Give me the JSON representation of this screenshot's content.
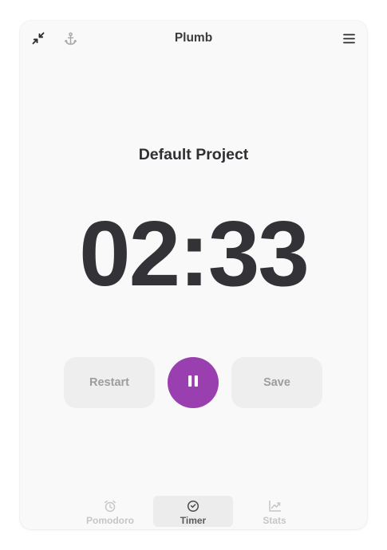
{
  "app": {
    "title": "Plumb"
  },
  "header": {
    "collapse_icon": "collapse-arrows-icon",
    "anchor_icon": "anchor-icon",
    "menu_icon": "hamburger-menu-icon"
  },
  "main": {
    "project_name": "Default Project",
    "time_display": "02:33"
  },
  "controls": {
    "restart_label": "Restart",
    "pause_icon": "pause-icon",
    "save_label": "Save"
  },
  "tabs": [
    {
      "label": "Pomodoro",
      "icon": "alarm-clock-icon",
      "active": false
    },
    {
      "label": "Timer",
      "icon": "clock-icon",
      "active": true
    },
    {
      "label": "Stats",
      "icon": "chart-line-icon",
      "active": false
    }
  ],
  "colors": {
    "accent": "#9a3fb0",
    "text_primary": "#323237",
    "button_bg": "#eeeeee",
    "button_text": "#9d9d9d",
    "tab_inactive": "#c6c6c6",
    "tab_active": "#5a5a5f",
    "window_bg": "#f9f9f9"
  }
}
